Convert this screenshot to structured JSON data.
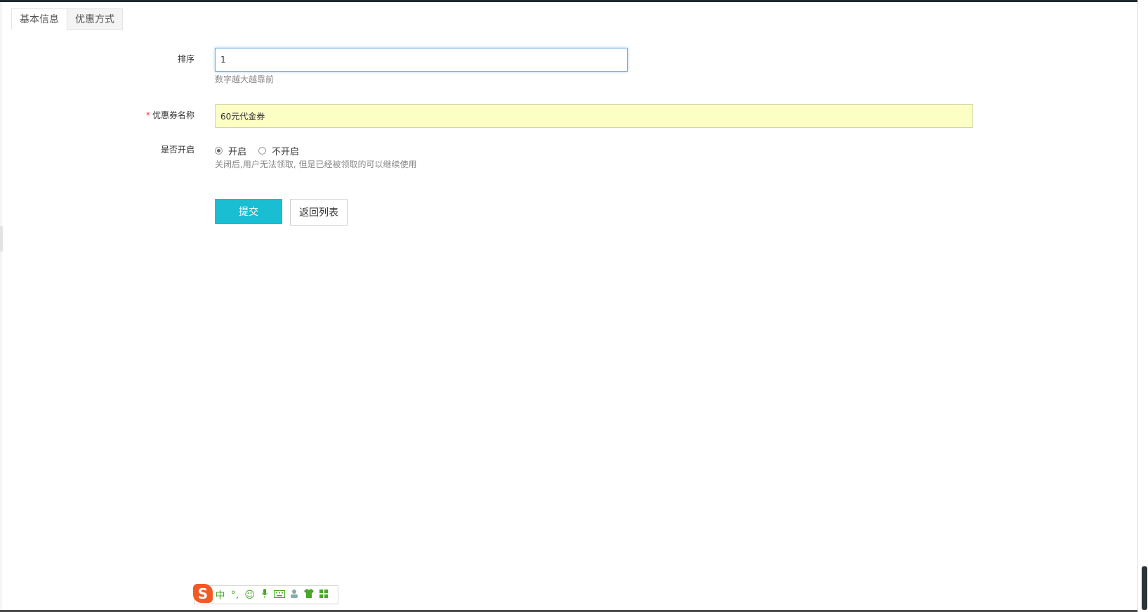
{
  "tabs": [
    {
      "label": "基本信息",
      "active": true
    },
    {
      "label": "优惠方式",
      "active": false
    }
  ],
  "form": {
    "sort": {
      "label": "排序",
      "value": "1",
      "help": "数字越大越靠前"
    },
    "name": {
      "required_mark": "*",
      "label": "优惠券名称",
      "value": "60元代金券"
    },
    "enabled": {
      "label": "是否开启",
      "options": [
        {
          "label": "开启",
          "checked": true
        },
        {
          "label": "不开启",
          "checked": false
        }
      ],
      "help": "关闭后,用户无法领取, 但是已经被领取的可以继续使用"
    }
  },
  "buttons": {
    "submit": "提交",
    "back": "返回列表"
  },
  "ime_toolbar": {
    "logo": "S",
    "items": [
      "中",
      "°,",
      "☺",
      "mic",
      "keyboard",
      "person",
      "shirt",
      "grid"
    ]
  },
  "colors": {
    "primary": "#19bed3",
    "input_focus": "#66afe9",
    "autofill": "#fbffc4",
    "required": "#e4393c"
  }
}
